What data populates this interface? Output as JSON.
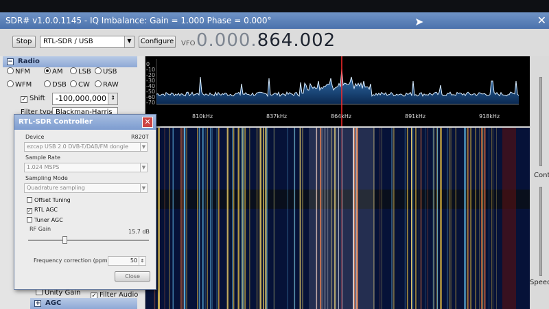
{
  "window": {
    "title": "SDR# v1.0.0.1145 - IQ Imbalance: Gain = 1.000 Phase = 0.000°"
  },
  "toolbar": {
    "stop_label": "Stop",
    "device": "RTL-SDR / USB",
    "configure_label": "Configure",
    "vfo_label": "VFO",
    "vfo_grey": "0.000.",
    "vfo_main": "864.002"
  },
  "radio": {
    "section_title": "Radio",
    "modes": [
      "NFM",
      "AM",
      "LSB",
      "USB",
      "WFM",
      "DSB",
      "CW",
      "RAW"
    ],
    "selected_mode": "AM",
    "shift_label": "Shift",
    "shift_value": "-100,000,000",
    "filter_label": "Filter type",
    "filter_value": "Blackman-Harris"
  },
  "bottom": {
    "unity_gain": "Unity Gain",
    "filter_audio": "Filter Audio",
    "agc_title": "AGC"
  },
  "spectrum": {
    "db_ticks": [
      "0",
      "-10",
      "-20",
      "-30",
      "-40",
      "-50",
      "-60",
      "-70"
    ],
    "freq_ticks": [
      "810kHz",
      "837kHz",
      "864kHz",
      "891kHz",
      "918kHz"
    ],
    "tuned_freq": "864kHz"
  },
  "right": {
    "contrast_label": "Contr",
    "speed_label": "Speed"
  },
  "dialog": {
    "title": "RTL-SDR Controller",
    "device_label": "Device",
    "tuner": "R820T",
    "device_value": "ezcap USB 2.0 DVB-T/DAB/FM dongle",
    "sample_rate_label": "Sample Rate",
    "sample_rate_value": "1.024 MSPS",
    "sampling_mode_label": "Sampling Mode",
    "sampling_mode_value": "Quadrature sampling",
    "offset_tuning": "Offset Tuning",
    "rtl_agc": "RTL AGC",
    "tuner_agc": "Tuner AGC",
    "rf_gain_label": "RF Gain",
    "rf_gain_value": "15.7 dB",
    "rf_gain_fraction": 0.3,
    "freq_corr_label": "Frequency correction (ppm)",
    "freq_corr_value": "50",
    "close_label": "Close"
  },
  "colors": {
    "accent": "#7d9cd0",
    "spectrum_trace": "#d8ecff",
    "tuned_line": "#ff2a2a"
  }
}
